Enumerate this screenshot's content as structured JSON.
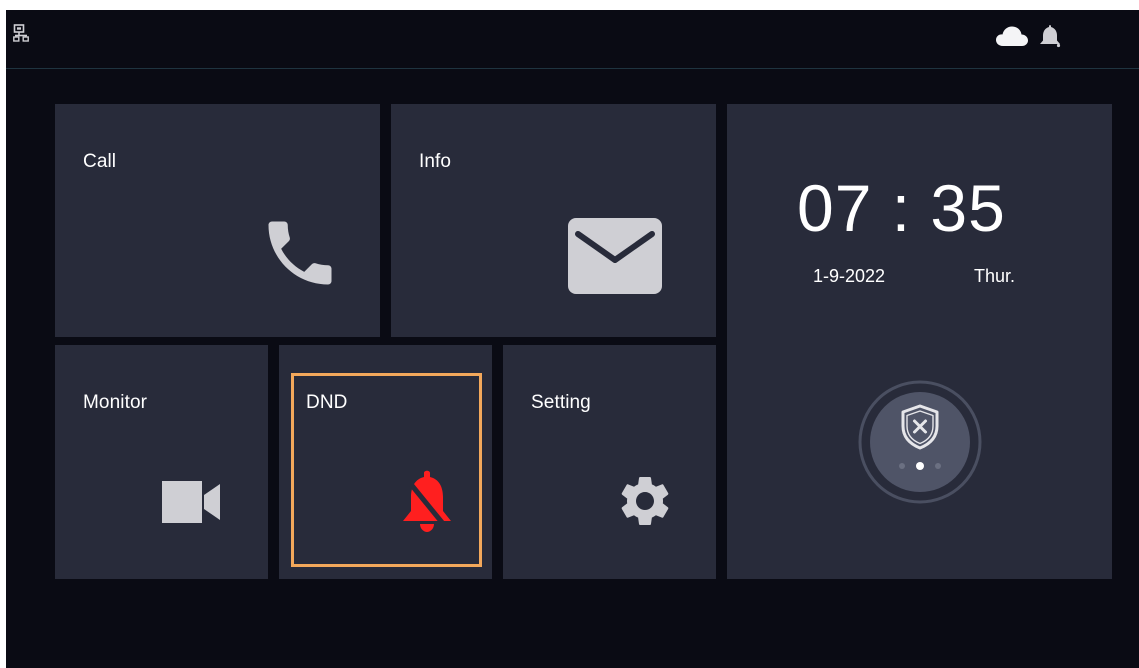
{
  "status_bar": {
    "network_icon": "network-icon",
    "cloud_icon": "cloud-icon",
    "bell_icon": "bell-icon"
  },
  "tiles": {
    "call": {
      "label": "Call",
      "icon": "phone-icon"
    },
    "info": {
      "label": "Info",
      "icon": "envelope-icon"
    },
    "monitor": {
      "label": "Monitor",
      "icon": "video-camera-icon"
    },
    "dnd": {
      "label": "DND",
      "icon": "bell-off-icon",
      "active": true
    },
    "setting": {
      "label": "Setting",
      "icon": "gear-icon"
    }
  },
  "clock": {
    "time": "07:35",
    "date": "1-9-2022",
    "day": "Thur."
  },
  "arm": {
    "icon": "shield-x-icon",
    "pages": 3,
    "current_page": 2
  },
  "colors": {
    "background": "#0a0b14",
    "tile": "#282b3a",
    "icon": "#cfcfd4",
    "dnd_active": "#ff1f1f",
    "selection": "#f3a85b"
  }
}
